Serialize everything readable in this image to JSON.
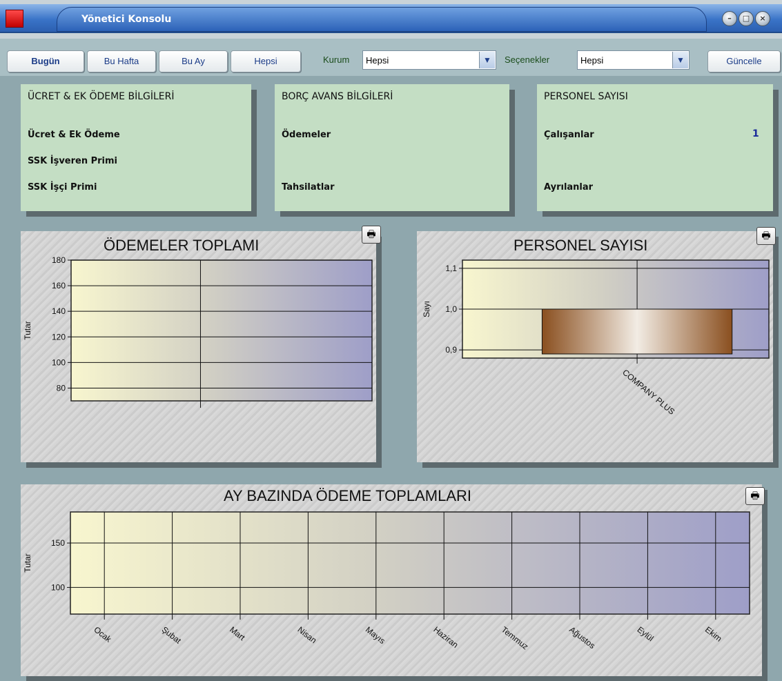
{
  "window": {
    "title": "Yönetici Konsolu"
  },
  "toolbar": {
    "today": "Bugün",
    "this_week": "Bu Hafta",
    "this_month": "Bu Ay",
    "all": "Hepsi",
    "kurum_label": "Kurum",
    "kurum_value": "Hepsi",
    "options_label": "Seçenekler",
    "options_value": "Hepsi",
    "refresh": "Güncelle"
  },
  "cards": {
    "ucret": {
      "title": "ÜCRET & EK ÖDEME BİLGİLERİ",
      "row1": "Ücret & Ek Ödeme",
      "row2": "SSK İşveren Primi",
      "row3": "SSK İşçi Primi"
    },
    "borc": {
      "title": "BORÇ AVANS BİLGİLERİ",
      "row1": "Ödemeler",
      "row2": "Tahsilatlar"
    },
    "personel": {
      "title": "PERSONEL SAYISI",
      "row1": "Çalışanlar",
      "row1_value": "1",
      "row2": "Ayrılanlar"
    }
  },
  "charts": {
    "odemeler": {
      "title": "ÖDEMELER TOPLAMI",
      "ylabel": "Tutar"
    },
    "personel": {
      "title": "PERSONEL SAYISI",
      "ylabel": "Sayı"
    },
    "aylik": {
      "title": "AY BAZINDA ÖDEME TOPLAMLARI",
      "ylabel": "Tutar"
    }
  },
  "chart_data": [
    {
      "type": "bar",
      "title": "ÖDEMELER TOPLAMI",
      "xlabel": "",
      "ylabel": "Tutar",
      "categories": [],
      "values": [],
      "ylim": [
        70,
        180
      ],
      "yticks": [
        "80",
        "100",
        "120",
        "140",
        "160",
        "180"
      ],
      "grid": true
    },
    {
      "type": "bar",
      "title": "PERSONEL SAYISI",
      "xlabel": "",
      "ylabel": "Sayı",
      "categories": [
        "COMPANY PLUS"
      ],
      "values": [
        1
      ],
      "ylim": [
        0.88,
        1.12
      ],
      "yticks": [
        "0,9",
        "1,0",
        "1,1"
      ],
      "grid": true,
      "bar_color": "#a0622b"
    },
    {
      "type": "bar",
      "title": "AY BAZINDA ÖDEME TOPLAMLARI",
      "xlabel": "",
      "ylabel": "Tutar",
      "categories": [
        "Ocak",
        "Şubat",
        "Mart",
        "Nisan",
        "Mayıs",
        "Haziran",
        "Temmuz",
        "Ağustos",
        "Eylül",
        "Ekim"
      ],
      "values": [],
      "ylim": [
        70,
        185
      ],
      "yticks": [
        "100",
        "150"
      ],
      "grid": true
    }
  ],
  "colors": {
    "card_bg": "#c4dec4",
    "title_bar": "#2c62b8",
    "link_text": "#1a3b87"
  }
}
